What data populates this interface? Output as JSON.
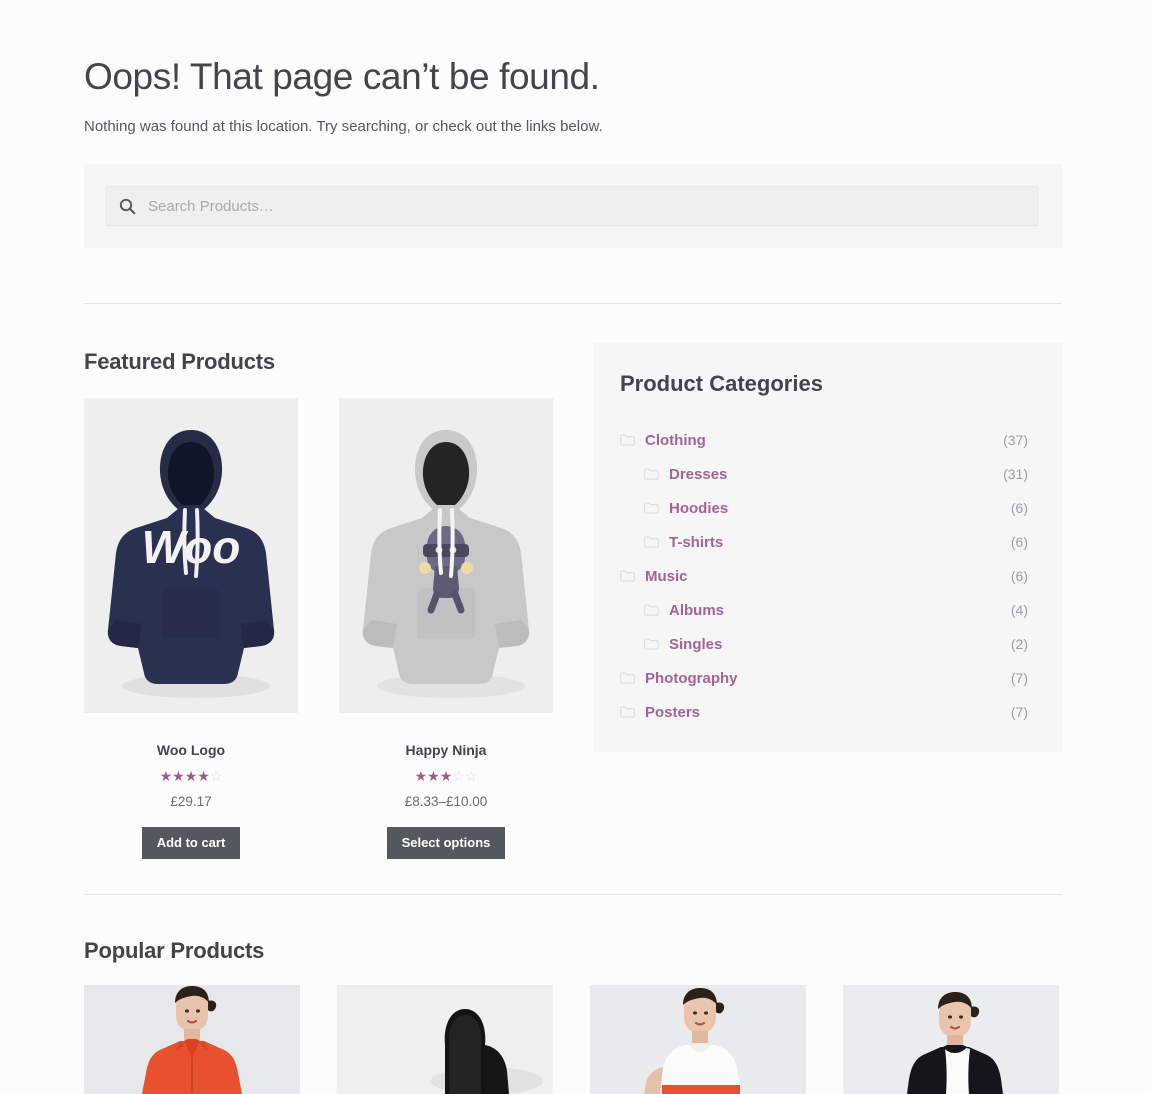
{
  "header": {
    "title": "Oops! That page can’t be found.",
    "lede": "Nothing was found at this location. Try searching, or check out the links below."
  },
  "search": {
    "placeholder": "Search Products…",
    "value": "",
    "icon": "search-icon"
  },
  "featured": {
    "title": "Featured Products",
    "products": [
      {
        "name": "Woo Logo",
        "price": "£29.17",
        "rating": 4,
        "rating_max": 5,
        "button_label": "Add to cart",
        "image_alt": "navy hoodie with white Woo logo"
      },
      {
        "name": "Happy Ninja",
        "price": "£8.33–£10.00",
        "rating": 3,
        "rating_max": 5,
        "button_label": "Select options",
        "image_alt": "grey hoodie with ninja character graphic"
      }
    ]
  },
  "categories": {
    "title": "Product Categories",
    "items": [
      {
        "label": "Clothing",
        "count": "(37)",
        "level": 0,
        "icon": "folder-icon"
      },
      {
        "label": "Dresses",
        "count": "(31)",
        "level": 1,
        "icon": "folder-icon"
      },
      {
        "label": "Hoodies",
        "count": "(6)",
        "level": 1,
        "icon": "folder-icon"
      },
      {
        "label": "T-shirts",
        "count": "(6)",
        "level": 1,
        "icon": "folder-icon"
      },
      {
        "label": "Music",
        "count": "(6)",
        "level": 0,
        "icon": "folder-icon"
      },
      {
        "label": "Albums",
        "count": "(4)",
        "level": 1,
        "icon": "folder-icon"
      },
      {
        "label": "Singles",
        "count": "(2)",
        "level": 1,
        "icon": "folder-icon"
      },
      {
        "label": "Photography",
        "count": "(7)",
        "level": 0,
        "icon": "folder-icon"
      },
      {
        "label": "Posters",
        "count": "(7)",
        "level": 0,
        "icon": "folder-icon"
      }
    ]
  },
  "popular": {
    "title": "Popular Products",
    "products": [
      {
        "image_alt": "model wearing orange red blouse"
      },
      {
        "image_alt": "black hood garment"
      },
      {
        "image_alt": "model wearing white top with red belt"
      },
      {
        "image_alt": "model wearing black and white colour block dress"
      }
    ]
  },
  "colors": {
    "accent": "#a46497",
    "star_filled": "#9b5c8f",
    "button_bg": "#53585f",
    "text": "#43454b",
    "page_bg": "#fcfcfc",
    "panel_bg": "#f6f6f6"
  }
}
